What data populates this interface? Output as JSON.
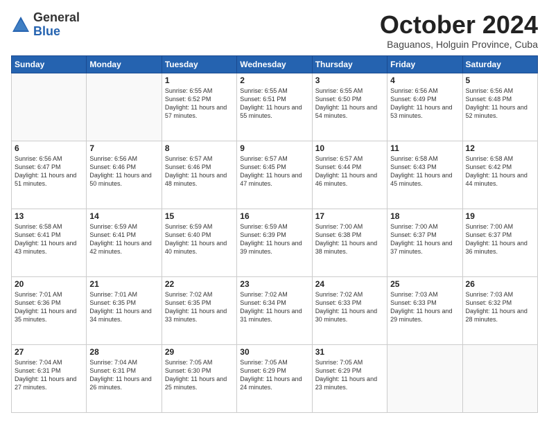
{
  "header": {
    "logo_general": "General",
    "logo_blue": "Blue",
    "month_title": "October 2024",
    "location": "Baguanos, Holguin Province, Cuba"
  },
  "weekdays": [
    "Sunday",
    "Monday",
    "Tuesday",
    "Wednesday",
    "Thursday",
    "Friday",
    "Saturday"
  ],
  "weeks": [
    [
      {
        "day": "",
        "info": ""
      },
      {
        "day": "",
        "info": ""
      },
      {
        "day": "1",
        "info": "Sunrise: 6:55 AM\nSunset: 6:52 PM\nDaylight: 11 hours and 57 minutes."
      },
      {
        "day": "2",
        "info": "Sunrise: 6:55 AM\nSunset: 6:51 PM\nDaylight: 11 hours and 55 minutes."
      },
      {
        "day": "3",
        "info": "Sunrise: 6:55 AM\nSunset: 6:50 PM\nDaylight: 11 hours and 54 minutes."
      },
      {
        "day": "4",
        "info": "Sunrise: 6:56 AM\nSunset: 6:49 PM\nDaylight: 11 hours and 53 minutes."
      },
      {
        "day": "5",
        "info": "Sunrise: 6:56 AM\nSunset: 6:48 PM\nDaylight: 11 hours and 52 minutes."
      }
    ],
    [
      {
        "day": "6",
        "info": "Sunrise: 6:56 AM\nSunset: 6:47 PM\nDaylight: 11 hours and 51 minutes."
      },
      {
        "day": "7",
        "info": "Sunrise: 6:56 AM\nSunset: 6:46 PM\nDaylight: 11 hours and 50 minutes."
      },
      {
        "day": "8",
        "info": "Sunrise: 6:57 AM\nSunset: 6:46 PM\nDaylight: 11 hours and 48 minutes."
      },
      {
        "day": "9",
        "info": "Sunrise: 6:57 AM\nSunset: 6:45 PM\nDaylight: 11 hours and 47 minutes."
      },
      {
        "day": "10",
        "info": "Sunrise: 6:57 AM\nSunset: 6:44 PM\nDaylight: 11 hours and 46 minutes."
      },
      {
        "day": "11",
        "info": "Sunrise: 6:58 AM\nSunset: 6:43 PM\nDaylight: 11 hours and 45 minutes."
      },
      {
        "day": "12",
        "info": "Sunrise: 6:58 AM\nSunset: 6:42 PM\nDaylight: 11 hours and 44 minutes."
      }
    ],
    [
      {
        "day": "13",
        "info": "Sunrise: 6:58 AM\nSunset: 6:41 PM\nDaylight: 11 hours and 43 minutes."
      },
      {
        "day": "14",
        "info": "Sunrise: 6:59 AM\nSunset: 6:41 PM\nDaylight: 11 hours and 42 minutes."
      },
      {
        "day": "15",
        "info": "Sunrise: 6:59 AM\nSunset: 6:40 PM\nDaylight: 11 hours and 40 minutes."
      },
      {
        "day": "16",
        "info": "Sunrise: 6:59 AM\nSunset: 6:39 PM\nDaylight: 11 hours and 39 minutes."
      },
      {
        "day": "17",
        "info": "Sunrise: 7:00 AM\nSunset: 6:38 PM\nDaylight: 11 hours and 38 minutes."
      },
      {
        "day": "18",
        "info": "Sunrise: 7:00 AM\nSunset: 6:37 PM\nDaylight: 11 hours and 37 minutes."
      },
      {
        "day": "19",
        "info": "Sunrise: 7:00 AM\nSunset: 6:37 PM\nDaylight: 11 hours and 36 minutes."
      }
    ],
    [
      {
        "day": "20",
        "info": "Sunrise: 7:01 AM\nSunset: 6:36 PM\nDaylight: 11 hours and 35 minutes."
      },
      {
        "day": "21",
        "info": "Sunrise: 7:01 AM\nSunset: 6:35 PM\nDaylight: 11 hours and 34 minutes."
      },
      {
        "day": "22",
        "info": "Sunrise: 7:02 AM\nSunset: 6:35 PM\nDaylight: 11 hours and 33 minutes."
      },
      {
        "day": "23",
        "info": "Sunrise: 7:02 AM\nSunset: 6:34 PM\nDaylight: 11 hours and 31 minutes."
      },
      {
        "day": "24",
        "info": "Sunrise: 7:02 AM\nSunset: 6:33 PM\nDaylight: 11 hours and 30 minutes."
      },
      {
        "day": "25",
        "info": "Sunrise: 7:03 AM\nSunset: 6:33 PM\nDaylight: 11 hours and 29 minutes."
      },
      {
        "day": "26",
        "info": "Sunrise: 7:03 AM\nSunset: 6:32 PM\nDaylight: 11 hours and 28 minutes."
      }
    ],
    [
      {
        "day": "27",
        "info": "Sunrise: 7:04 AM\nSunset: 6:31 PM\nDaylight: 11 hours and 27 minutes."
      },
      {
        "day": "28",
        "info": "Sunrise: 7:04 AM\nSunset: 6:31 PM\nDaylight: 11 hours and 26 minutes."
      },
      {
        "day": "29",
        "info": "Sunrise: 7:05 AM\nSunset: 6:30 PM\nDaylight: 11 hours and 25 minutes."
      },
      {
        "day": "30",
        "info": "Sunrise: 7:05 AM\nSunset: 6:29 PM\nDaylight: 11 hours and 24 minutes."
      },
      {
        "day": "31",
        "info": "Sunrise: 7:05 AM\nSunset: 6:29 PM\nDaylight: 11 hours and 23 minutes."
      },
      {
        "day": "",
        "info": ""
      },
      {
        "day": "",
        "info": ""
      }
    ]
  ]
}
